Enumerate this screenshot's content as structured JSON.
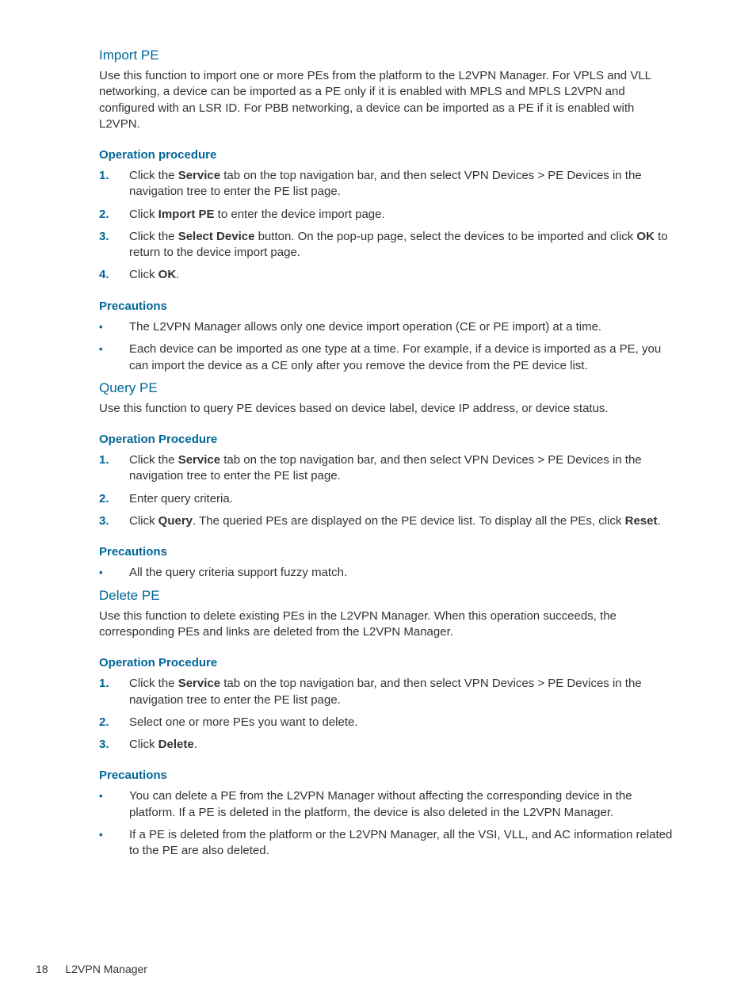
{
  "sections": [
    {
      "title": "Import PE",
      "intro": "Use this function to import one or more PEs from the platform to the L2VPN Manager. For VPLS and VLL networking, a device can be imported as a PE only if it is enabled with MPLS and MPLS L2VPN and configured with an LSR ID. For PBB networking, a device can be imported as a PE if it is enabled with L2VPN.",
      "procedure_heading": "Operation procedure",
      "steps": [
        [
          [
            "Click the "
          ],
          [
            "b",
            "Service"
          ],
          [
            " tab on the top navigation bar, and then select VPN Devices > PE Devices in the navigation tree to enter the PE list page."
          ]
        ],
        [
          [
            "Click "
          ],
          [
            "b",
            "Import PE"
          ],
          [
            " to enter the device import page."
          ]
        ],
        [
          [
            "Click the "
          ],
          [
            "b",
            "Select Device"
          ],
          [
            " button. On the pop-up page, select the devices to be imported and click "
          ],
          [
            "b",
            "OK"
          ],
          [
            " to return to the device import page."
          ]
        ],
        [
          [
            "Click "
          ],
          [
            "b",
            "OK"
          ],
          [
            "."
          ]
        ]
      ],
      "precautions_heading": "Precautions",
      "precautions": [
        [
          [
            "The L2VPN Manager allows only one device import operation (CE or PE import) at a time."
          ]
        ],
        [
          [
            "Each device can be imported as one type at a time. For example, if a device is imported as a PE, you can import the device as a CE only after you remove the device from the PE device list."
          ]
        ]
      ]
    },
    {
      "title": "Query PE",
      "intro": "Use this function to query PE devices based on device label, device IP address, or device status.",
      "procedure_heading": "Operation Procedure",
      "steps": [
        [
          [
            "Click the "
          ],
          [
            "b",
            "Service"
          ],
          [
            " tab on the top navigation bar, and then select VPN Devices > PE Devices in the navigation tree to enter the PE list page."
          ]
        ],
        [
          [
            "Enter query criteria."
          ]
        ],
        [
          [
            "Click "
          ],
          [
            "b",
            "Query"
          ],
          [
            ". The queried PEs are displayed on the PE device list. To display all the PEs, click "
          ],
          [
            "b",
            "Reset"
          ],
          [
            "."
          ]
        ]
      ],
      "precautions_heading": "Precautions",
      "precautions": [
        [
          [
            "All the query criteria support fuzzy match."
          ]
        ]
      ]
    },
    {
      "title": "Delete PE",
      "intro": "Use this function to delete existing PEs in the L2VPN Manager. When this operation succeeds, the corresponding PEs and links are deleted from the L2VPN Manager.",
      "procedure_heading": "Operation Procedure",
      "steps": [
        [
          [
            "Click the "
          ],
          [
            "b",
            "Service"
          ],
          [
            " tab on the top navigation bar, and then select VPN Devices > PE Devices in the navigation tree to enter the PE list page."
          ]
        ],
        [
          [
            "Select one or more PEs you want to delete."
          ]
        ],
        [
          [
            "Click "
          ],
          [
            "b",
            "Delete"
          ],
          [
            "."
          ]
        ]
      ],
      "precautions_heading": "Precautions",
      "precautions": [
        [
          [
            "You can delete a PE from the L2VPN Manager without affecting the corresponding device in the platform. If a PE is deleted in the platform, the device is also deleted in the L2VPN Manager."
          ]
        ],
        [
          [
            "If a PE is deleted from the platform or the L2VPN Manager, all the VSI, VLL, and AC information related to the PE are also deleted."
          ]
        ]
      ]
    }
  ],
  "footer": {
    "page": "18",
    "chapter": "L2VPN Manager"
  }
}
